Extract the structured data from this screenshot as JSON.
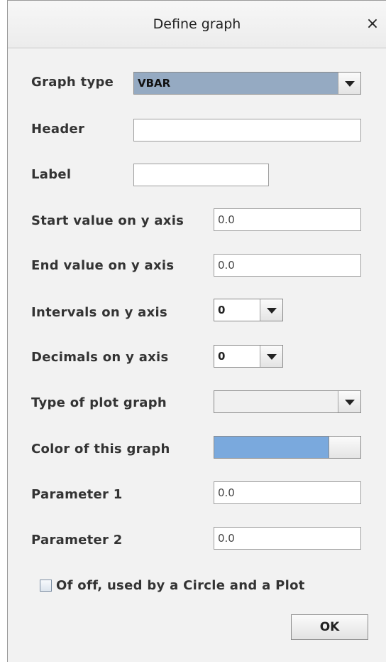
{
  "window": {
    "title": "Define graph",
    "close_symbol": "×"
  },
  "fields": {
    "graph_type": {
      "label": "Graph type",
      "value": "VBAR"
    },
    "header": {
      "label": "Header",
      "value": ""
    },
    "label": {
      "label": "Label",
      "value": ""
    },
    "start_y": {
      "label": "Start value on y axis",
      "value": "0.0"
    },
    "end_y": {
      "label": "End value on y axis",
      "value": "0.0"
    },
    "intervals_y": {
      "label": "Intervals on y axis",
      "value": "0"
    },
    "decimals_y": {
      "label": "Decimals on y axis",
      "value": "0"
    },
    "plot_type": {
      "label": "Type of plot graph",
      "value": ""
    },
    "color": {
      "label": "Color of this graph",
      "swatch": "#7aa9dd"
    },
    "parameter1": {
      "label": "Parameter 1",
      "value": "0.0"
    },
    "parameter2": {
      "label": "Parameter 2",
      "value": "0.0"
    }
  },
  "checkbox": {
    "label": "Of off, used by a Circle and a Plot",
    "checked": false
  },
  "buttons": {
    "ok": "OK"
  }
}
